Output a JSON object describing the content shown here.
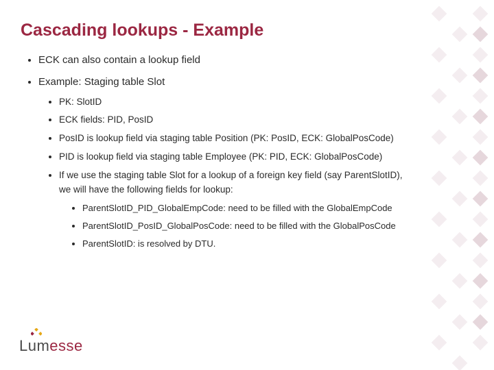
{
  "title": "Cascading lookups - Example",
  "bullets": {
    "b1": "ECK can also contain a lookup field",
    "b2": "Example: Staging table Slot",
    "s1": "PK: SlotID",
    "s2": "ECK fields: PID, PosID",
    "s3": "PosID is lookup field via staging table Position (PK: PosID, ECK: GlobalPosCode)",
    "s4": "PID is lookup field via staging table Employee (PK: PID, ECK: GlobalPosCode)",
    "s5": "If we use the staging table Slot for a lookup of a foreign key field (say ParentSlotID), we will have the following fields for lookup:",
    "t1": "ParentSlotID_PID_GlobalEmpCode: need to be filled with the GlobalEmpCode",
    "t2": "ParentSlotID_PosID_GlobalPosCode: need to be filled with the GlobalPosCode",
    "t3": "ParentSlotID: is resolved by DTU."
  },
  "logo": {
    "part1": "Lum",
    "part2": "esse"
  },
  "colors": {
    "accent": "#9b2742",
    "text": "#2a2a2a",
    "deco_light": "#f5f0f2",
    "deco_med": "#decdd3"
  }
}
